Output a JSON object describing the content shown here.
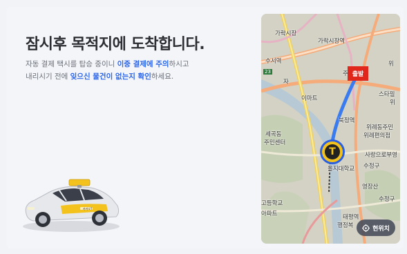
{
  "title": "잠시후 목적지에 도착합니다.",
  "description": {
    "line1_prefix": "자동 결제 택시를 탑승 중이니 ",
    "line1_highlight": "이중 결제에 주의",
    "line1_suffix": "하시고",
    "line2_prefix": "내리시기 전에 ",
    "line2_highlight": "잊으신 물건이 없는지 확인",
    "line2_suffix": "하세요."
  },
  "map": {
    "labels": {
      "garak_market": "가락시장",
      "garak_market_station": "가락시장역",
      "susu": "수서역",
      "road_23": "23",
      "ja": "자",
      "emart": "이마트",
      "sekok": "세곡동",
      "sekok_center": "주민센터",
      "bukjeong": "북정역",
      "jugong": "주",
      "wirye": "위례",
      "star": "스타필",
      "wirye_center": "위례동주민",
      "wirye_post": "위례편의점",
      "sarang": "사랑으로부영",
      "sujeong": "수정구",
      "eulji": "을지대학교",
      "yeongjang": "영장산",
      "sujeonggu2": "수정구",
      "highschool": "고등학교",
      "apt": "아파트",
      "taepyeong": "태평역",
      "admin": "행정복",
      "right_top": "위",
      "wirye2": "위"
    },
    "depart_label": "출발",
    "taxi_glyph": "T",
    "current_location_label": "현위치"
  },
  "colors": {
    "highlight": "#2c66e8",
    "route": "#3b7bf0",
    "depart": "#e1261c",
    "taxi_yellow": "#f4c21c"
  },
  "car": {
    "plate_text": "카카오T",
    "icon": "taxi-car-illustration"
  }
}
